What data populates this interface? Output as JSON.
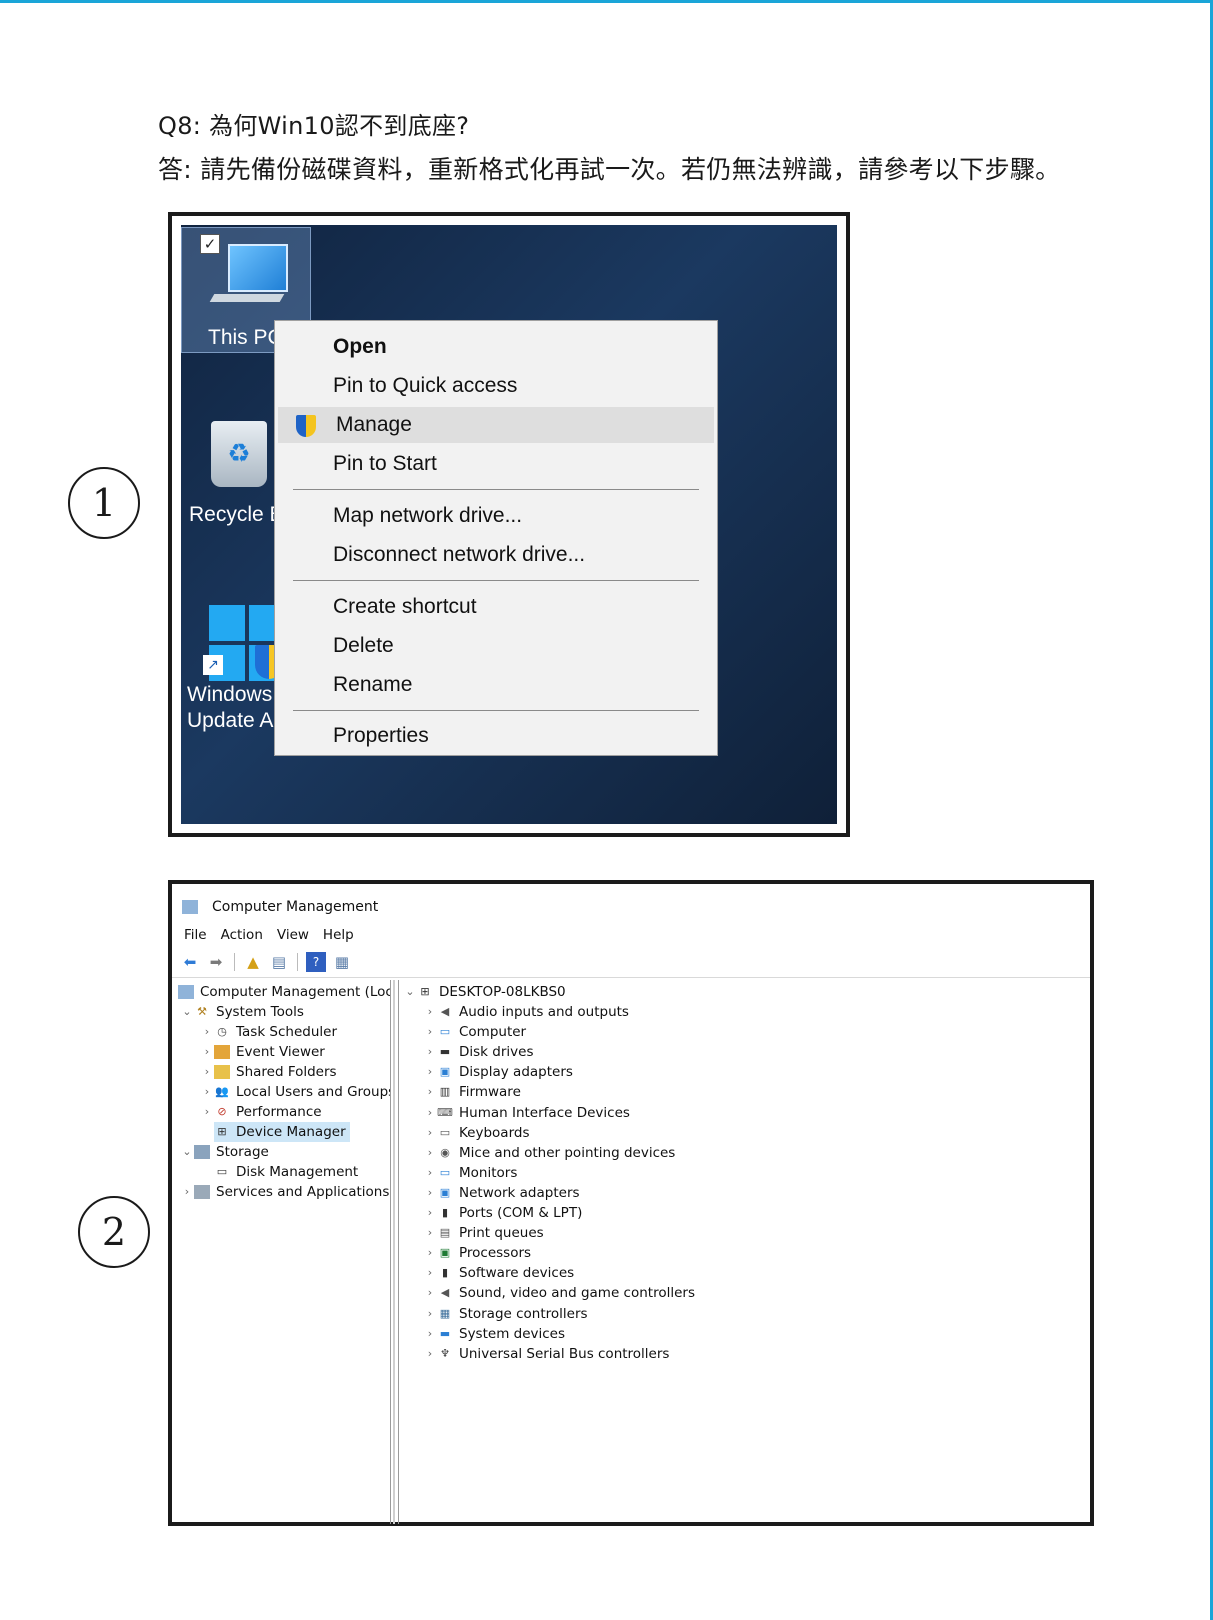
{
  "colors": {
    "accent": "#1aa5d8",
    "desktop_bg": "#15305a",
    "menu_bg": "#f2f2f2",
    "menu_highlight": "#dedede",
    "selected_tree": "#cde6f7"
  },
  "question": {
    "q": "Q8: 為何Win10認不到底座?",
    "a": "答: 請先備份磁碟資料，重新格式化再試一次。若仍無法辨識，請參考以下步驟。"
  },
  "steps": [
    "1",
    "2"
  ],
  "desktop": {
    "icons": [
      "This PC",
      "Recycle B",
      "Windows",
      "Update A"
    ],
    "context_menu": [
      "Open",
      "Pin to Quick access",
      "Manage",
      "Pin to Start",
      "Map network drive...",
      "Disconnect network drive...",
      "Create shortcut",
      "Delete",
      "Rename",
      "Properties"
    ]
  },
  "mgmt": {
    "title": "Computer Management",
    "menu": [
      "File",
      "Action",
      "View",
      "Help"
    ],
    "left_tree": [
      {
        "label": "Computer Management (Local",
        "icon": "computer-management-icon"
      },
      {
        "label": "System Tools",
        "icon": "tools-icon"
      },
      {
        "label": "Task Scheduler",
        "icon": "clock-icon"
      },
      {
        "label": "Event Viewer",
        "icon": "event-viewer-icon"
      },
      {
        "label": "Shared Folders",
        "icon": "shared-folder-icon"
      },
      {
        "label": "Local Users and Groups",
        "icon": "users-icon"
      },
      {
        "label": "Performance",
        "icon": "performance-icon"
      },
      {
        "label": "Device Manager",
        "icon": "device-manager-icon"
      },
      {
        "label": "Storage",
        "icon": "storage-icon"
      },
      {
        "label": "Disk Management",
        "icon": "disk-icon"
      },
      {
        "label": "Services and Applications",
        "icon": "services-icon"
      }
    ],
    "root": "DESKTOP-08LKBS0",
    "devices": [
      "Audio inputs and outputs",
      "Computer",
      "Disk drives",
      "Display adapters",
      "Firmware",
      "Human Interface Devices",
      "Keyboards",
      "Mice and other pointing devices",
      "Monitors",
      "Network adapters",
      "Ports (COM & LPT)",
      "Print queues",
      "Processors",
      "Software devices",
      "Sound, video and game controllers",
      "Storage controllers",
      "System devices",
      "Universal Serial Bus controllers"
    ]
  }
}
